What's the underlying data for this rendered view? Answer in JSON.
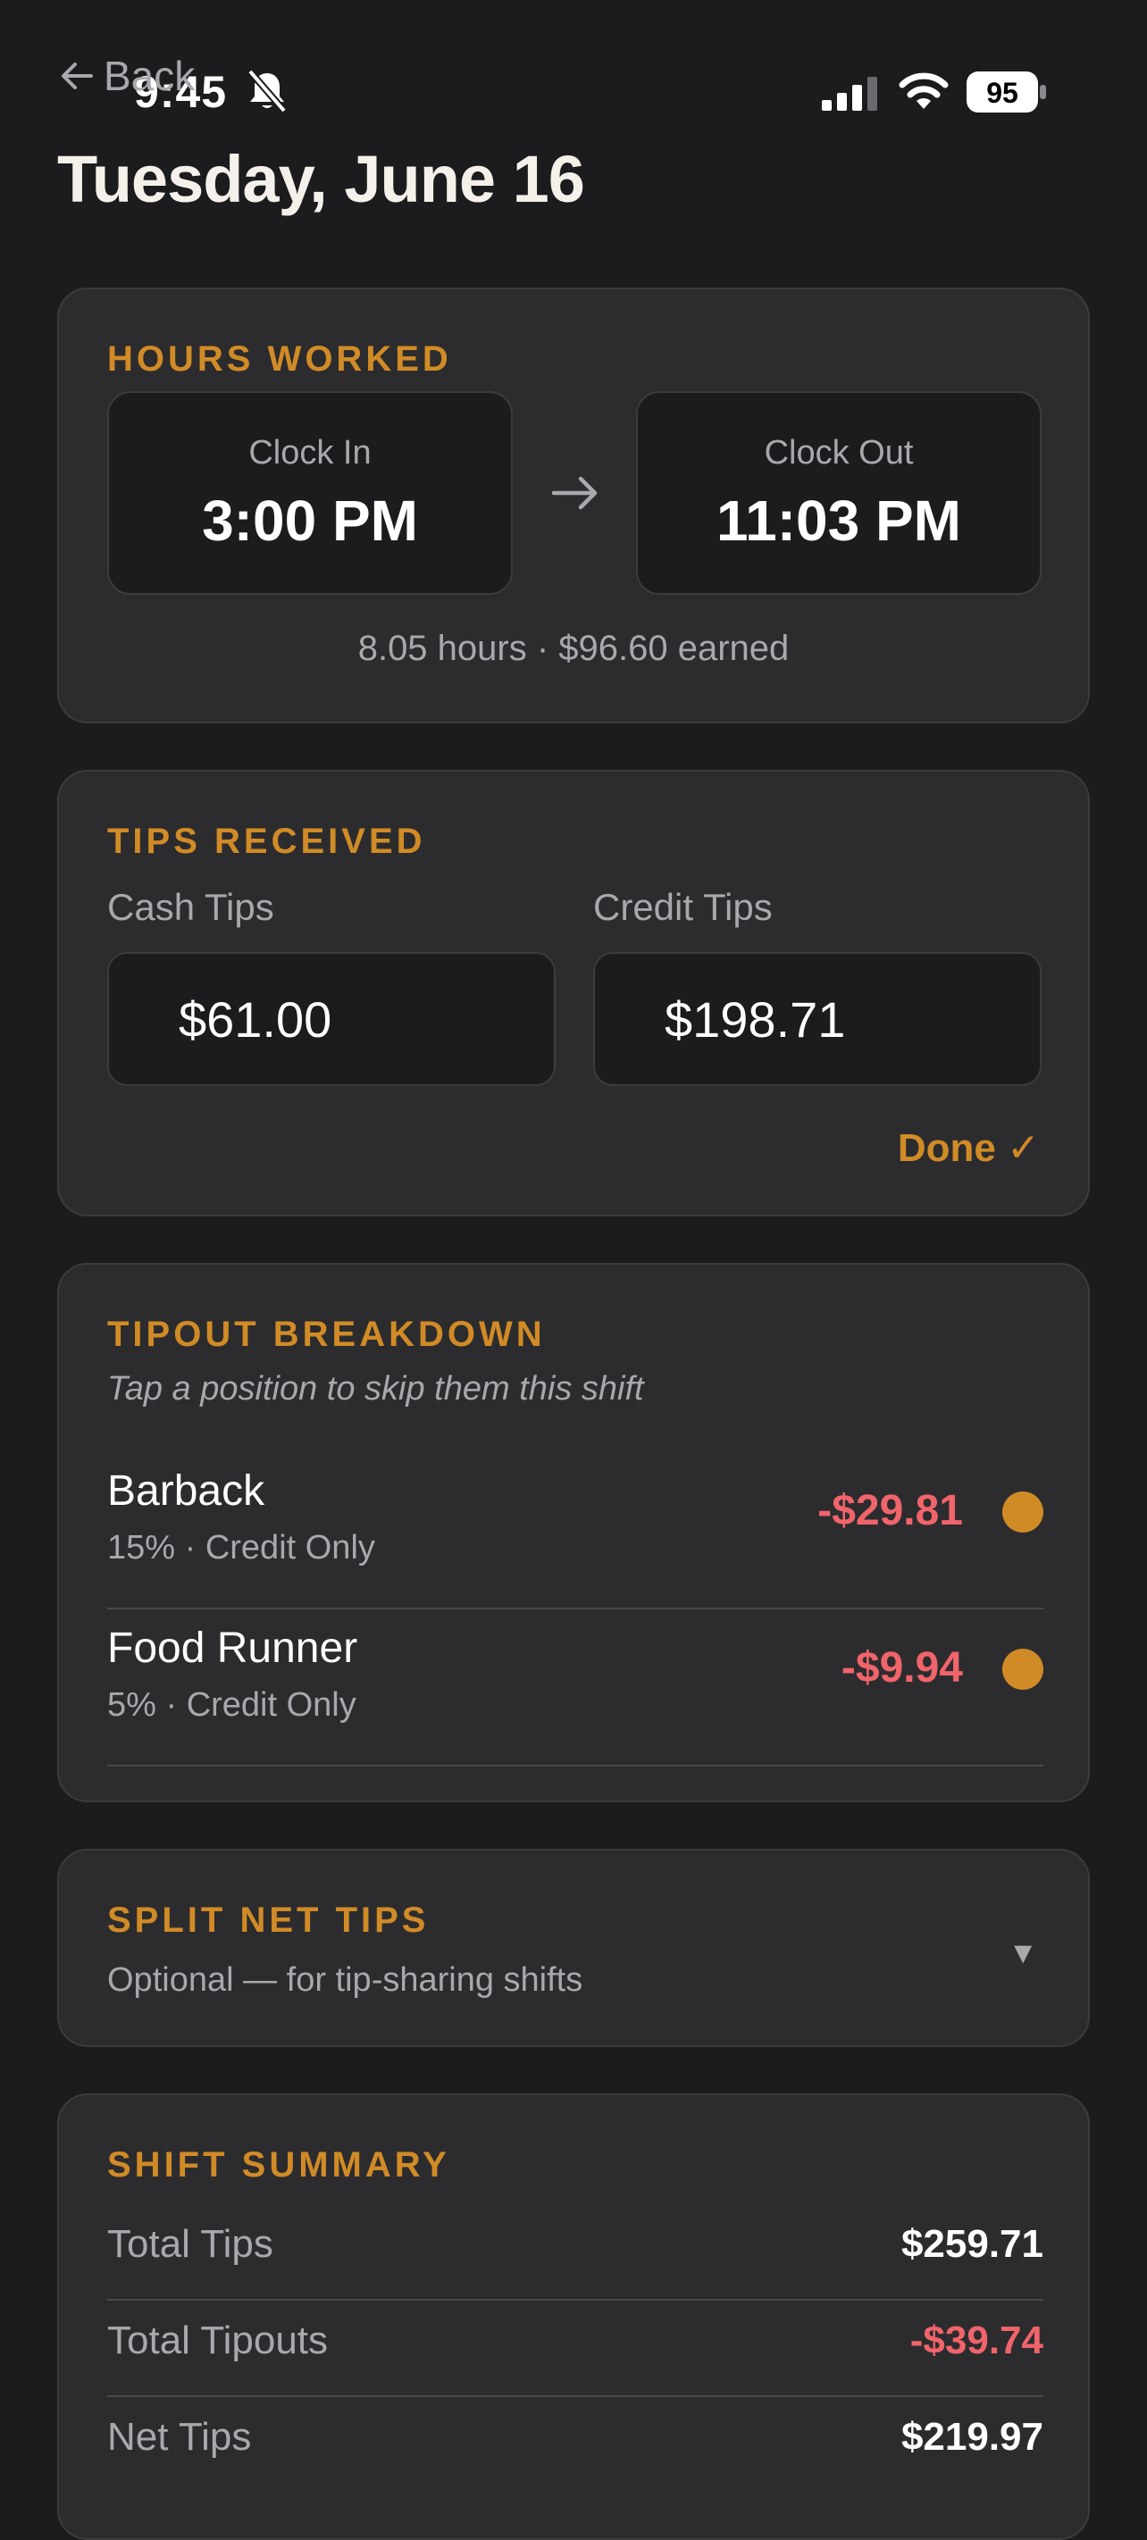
{
  "status_bar": {
    "time": "9:45",
    "battery": "95"
  },
  "nav": {
    "back_label": "Back"
  },
  "page": {
    "title": "Tuesday, June 16"
  },
  "hours": {
    "section_label": "HOURS WORKED",
    "clock_in_label": "Clock In",
    "clock_in_value": "3:00 PM",
    "clock_out_label": "Clock Out",
    "clock_out_value": "11:03 PM",
    "summary": "8.05 hours · $96.60 earned"
  },
  "tips": {
    "section_label": "TIPS RECEIVED",
    "cash_label": "Cash Tips",
    "cash_value": "$61.00",
    "credit_label": "Credit Tips",
    "credit_value": "$198.71",
    "done_label": "Done ✓"
  },
  "tipout": {
    "section_label": "TIPOUT BREAKDOWN",
    "hint": "Tap a position to skip them this shift",
    "items": [
      {
        "name": "Barback",
        "detail": "15% · Credit Only",
        "amount": "-$29.81"
      },
      {
        "name": "Food Runner",
        "detail": "5% · Credit Only",
        "amount": "-$9.94"
      }
    ]
  },
  "split": {
    "section_label": "SPLIT NET TIPS",
    "subtitle": "Optional — for tip-sharing shifts",
    "chevron": "▼"
  },
  "summary": {
    "section_label": "SHIFT SUMMARY",
    "rows": [
      {
        "label": "Total Tips",
        "value": "$259.71"
      },
      {
        "label": "Total Tipouts",
        "value": "-$39.74"
      },
      {
        "label": "Net Tips",
        "value": "$219.97"
      }
    ]
  },
  "colors": {
    "accent": "#d18b26",
    "negative": "#f0646b",
    "background": "#1c1c1e",
    "card": "#2c2c2e"
  }
}
